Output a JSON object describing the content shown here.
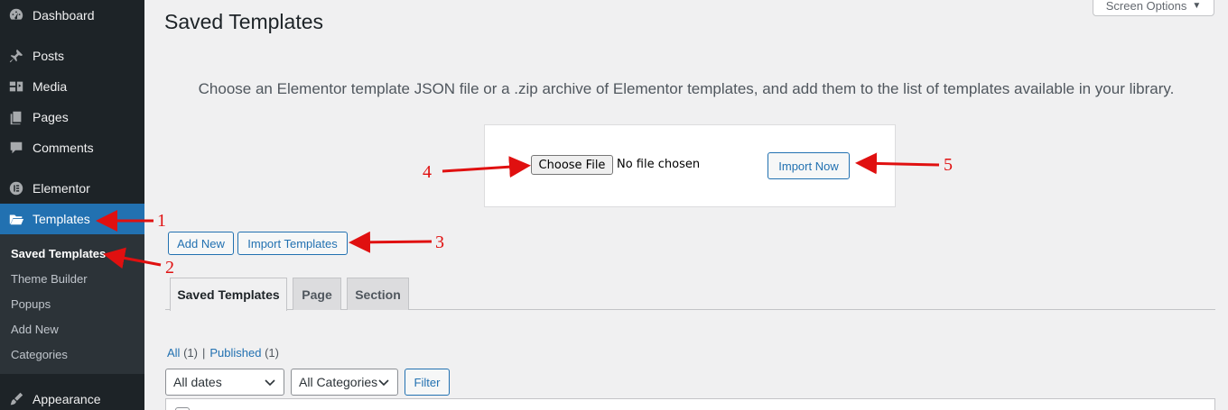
{
  "sidebar": {
    "items": [
      {
        "label": "Dashboard",
        "icon": "dashboard-icon"
      },
      {
        "label": "Posts",
        "icon": "pin-icon"
      },
      {
        "label": "Media",
        "icon": "media-icon"
      },
      {
        "label": "Pages",
        "icon": "pages-icon"
      },
      {
        "label": "Comments",
        "icon": "comments-icon"
      },
      {
        "label": "Elementor",
        "icon": "elementor-icon"
      },
      {
        "label": "Templates",
        "icon": "folder-icon"
      },
      {
        "label": "Appearance",
        "icon": "brush-icon"
      }
    ],
    "submenu": [
      "Saved Templates",
      "Theme Builder",
      "Popups",
      "Add New",
      "Categories"
    ]
  },
  "header": {
    "title": "Saved Templates",
    "screen_options": "Screen Options"
  },
  "import": {
    "intro": "Choose an Elementor template JSON file or a .zip archive of Elementor templates, and add them to the list of templates available in your library.",
    "choose_file": "Choose File",
    "no_file": "No file chosen",
    "import_now": "Import Now"
  },
  "actions": {
    "add_new": "Add New",
    "import_templates": "Import Templates"
  },
  "tabs": [
    "Saved Templates",
    "Page",
    "Section"
  ],
  "views": {
    "all": "All",
    "all_count": "(1)",
    "separator": "|",
    "published": "Published",
    "published_count": "(1)"
  },
  "filters": {
    "dates": "All dates",
    "categories": "All Categories",
    "filter": "Filter"
  },
  "annotations": [
    "1",
    "2",
    "3",
    "4",
    "5"
  ],
  "colors": {
    "sidebar_bg": "#1d2327",
    "accent": "#2271b1",
    "annotation": "#e01010"
  }
}
